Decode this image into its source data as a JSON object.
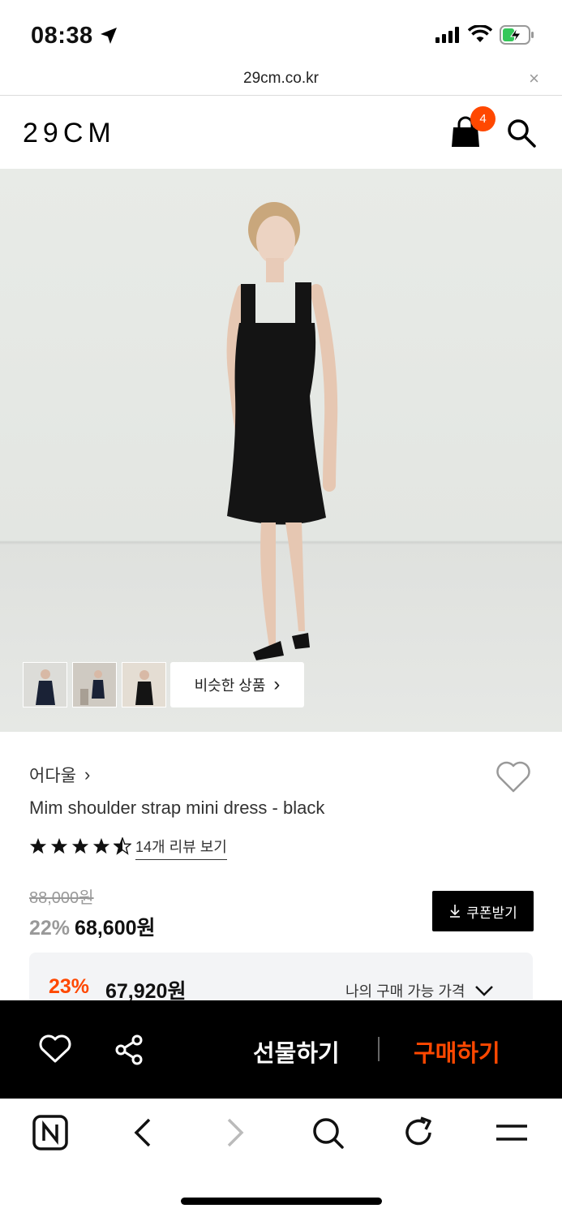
{
  "status_bar": {
    "time": "08:38"
  },
  "browser": {
    "url": "29cm.co.kr",
    "close_icon": "×"
  },
  "header": {
    "logo": "29CM",
    "cart_count": "4"
  },
  "hero": {
    "similar_label": "비슷한 상품",
    "similar_arrow": "›"
  },
  "product": {
    "brand": "어다울",
    "brand_arrow": "›",
    "name": "Mim shoulder strap mini dress - black",
    "rating_stars": 4.5,
    "review_link": "14개 리뷰 보기",
    "original_price": "88,000원",
    "discount": "22%",
    "price": "68,600원",
    "coupon_label": "쿠폰받기",
    "my_discount": "23%",
    "my_price": "67,920원",
    "my_price_label": "나의 구매 가능 가격"
  },
  "action_bar": {
    "gift_label": "선물하기",
    "buy_label": "구매하기"
  },
  "colors": {
    "accent": "#ff4800",
    "dark": "#000000",
    "muted": "#999999"
  }
}
